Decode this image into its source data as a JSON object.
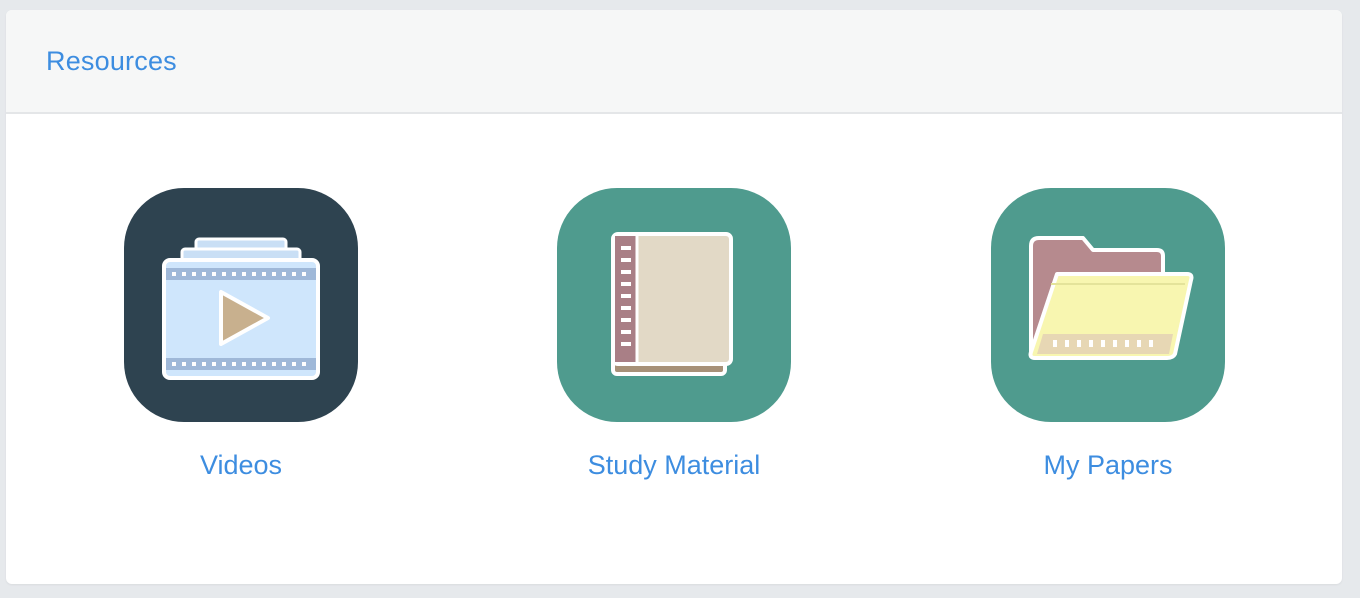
{
  "panel": {
    "title": "Resources"
  },
  "resources": [
    {
      "label": "Videos",
      "icon": "video-player-icon",
      "color": "#2e4350"
    },
    {
      "label": "Study Material",
      "icon": "notebook-icon",
      "color": "#4f9b8e"
    },
    {
      "label": "My Papers",
      "icon": "open-folder-icon",
      "color": "#4f9b8e"
    }
  ],
  "colors": {
    "link": "#3d8de0",
    "header_bg": "#f6f7f7",
    "page_bg": "#e6e9ec"
  }
}
